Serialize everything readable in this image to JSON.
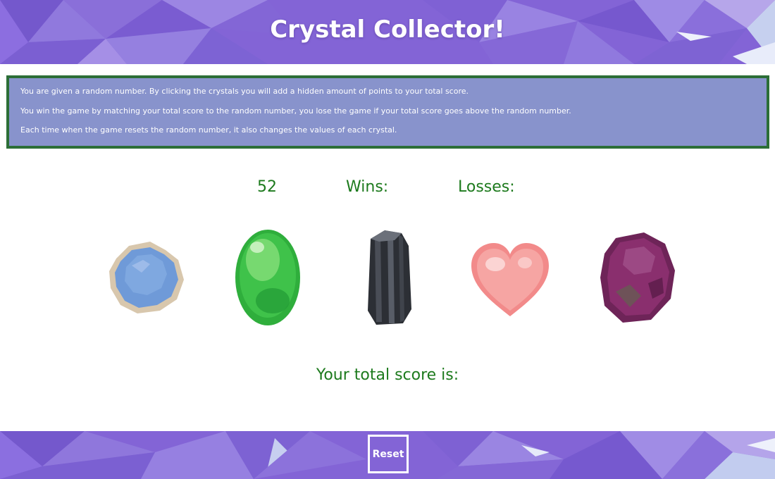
{
  "app": {
    "title": "Crystal Collector!"
  },
  "instructions": [
    "You are given a random number. By clicking the crystals you will add a hidden amount of points to your total score.",
    "You win the game by matching your total score to the random number, you lose the game if your total score goes above the random number.",
    "Each time when the game resets the random number, it also changes the values of each crystal."
  ],
  "stats": {
    "random_number": "52",
    "wins_label": "Wins:",
    "losses_label": "Losses:"
  },
  "crystals": [
    {
      "name": "blue-crystal-icon",
      "color": "#6f9ad8"
    },
    {
      "name": "green-crystal-icon",
      "color": "#3fc24a"
    },
    {
      "name": "black-crystal-icon",
      "color": "#3a3d44"
    },
    {
      "name": "pink-heart-crystal-icon",
      "color": "#f49a9a"
    },
    {
      "name": "purple-crystal-icon",
      "color": "#8a2f6e"
    }
  ],
  "total": {
    "label": "Your total score is:"
  },
  "footer": {
    "reset_label": "Reset"
  },
  "colors": {
    "banner": "#8364d6",
    "panel": "#8893cc",
    "panel_border": "#2c6e37",
    "text_green": "#1d7a1d"
  }
}
